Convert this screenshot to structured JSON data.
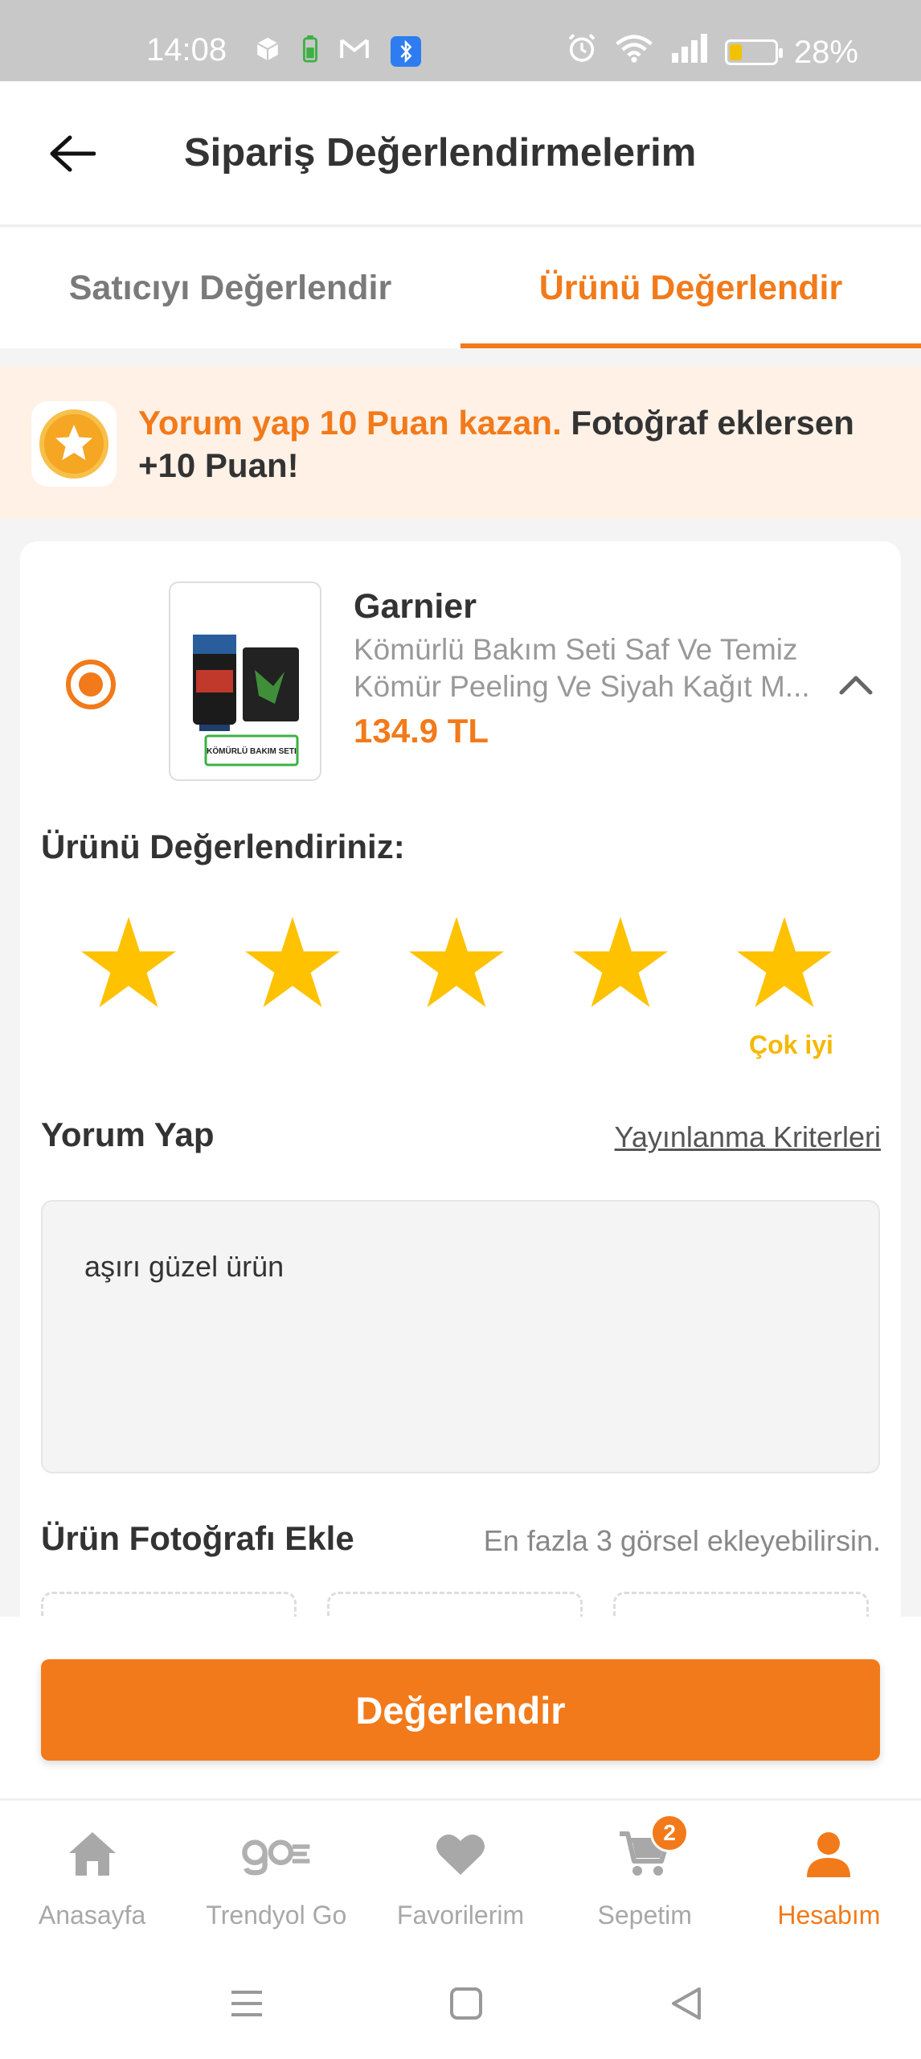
{
  "status_bar": {
    "time": "14:08",
    "battery_percent": "28%",
    "battery_level": 0.28,
    "left_icons": [
      "cube-icon",
      "battery-saver-icon",
      "gmail-icon",
      "bluetooth-icon"
    ],
    "right_icons": [
      "alarm-icon",
      "wifi-icon",
      "signal-icon",
      "battery-icon"
    ]
  },
  "header": {
    "title": "Sipariş Değerlendirmelerim",
    "back_icon": "arrow-left-icon"
  },
  "tabs": [
    {
      "label": "Satıcıyı Değerlendir",
      "active": false
    },
    {
      "label": "Ürünü Değerlendir",
      "active": true
    }
  ],
  "promo": {
    "highlight": "Yorum yap 10 Puan kazan.",
    "text": " Fotoğraf eklersen +10 Puan!",
    "icon": "star-badge-icon"
  },
  "product": {
    "brand": "Garnier",
    "name_line1": "Kömürlü Bakım Seti Saf Ve Temiz",
    "name_line2": "Kömür Peeling Ve Siyah Kağıt M...",
    "price": "134.9 TL",
    "image_label": "KÖMÜRLÜ BAKIM SETI",
    "selected": true
  },
  "rating": {
    "label": "Ürünü Değerlendiriniz:",
    "value": 5,
    "max": 5,
    "value_text": "Çok iyi",
    "star_color": "#FFC200"
  },
  "comment": {
    "label": "Yorum Yap",
    "criteria_link": "Yayınlanma Kriterleri",
    "value": "aşırı güzel ürün"
  },
  "photos": {
    "label": "Ürün Fotoğrafı Ekle",
    "hint": "En fazla 3 görsel ekleyebilirsin."
  },
  "submit_label": "Değerlendir",
  "bottom_nav": [
    {
      "label": "Anasayfa",
      "icon": "home-icon",
      "active": false
    },
    {
      "label": "Trendyol Go",
      "icon": "go-icon",
      "active": false
    },
    {
      "label": "Favorilerim",
      "icon": "heart-icon",
      "active": false
    },
    {
      "label": "Sepetim",
      "icon": "cart-icon",
      "active": false,
      "badge": "2"
    },
    {
      "label": "Hesabım",
      "icon": "user-icon",
      "active": true
    }
  ],
  "colors": {
    "accent": "#F27A1A",
    "promo_bg": "#FFF1E6",
    "star": "#FFC200",
    "inactive": "#A8A8A8"
  }
}
